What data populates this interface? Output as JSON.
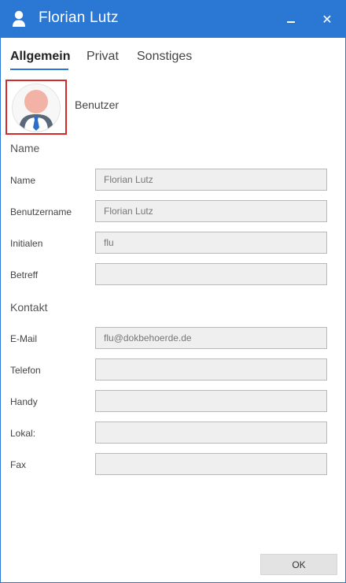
{
  "window": {
    "title": "Florian Lutz",
    "minimize_icon": "minimize-icon",
    "close_label": "✕",
    "accent_color": "#2b78d4"
  },
  "tabs": [
    {
      "label": "Allgemein",
      "active": true
    },
    {
      "label": "Privat",
      "active": false
    },
    {
      "label": "Sonstiges",
      "active": false
    }
  ],
  "avatar": {
    "caption": "Benutzer",
    "highlight_color": "#d42a2a"
  },
  "sections": {
    "name": "Name",
    "contact": "Kontakt"
  },
  "fields": {
    "name": {
      "label": "Name",
      "value": "Florian Lutz"
    },
    "username": {
      "label": "Benutzername",
      "value": "Florian Lutz"
    },
    "initials": {
      "label": "Initialen",
      "value": "flu"
    },
    "subject": {
      "label": "Betreff",
      "value": ""
    },
    "email": {
      "label": "E-Mail",
      "value": "flu@dokbehoerde.de"
    },
    "phone": {
      "label": "Telefon",
      "value": ""
    },
    "mobile": {
      "label": "Handy",
      "value": ""
    },
    "local": {
      "label": "Lokal:",
      "value": ""
    },
    "fax": {
      "label": "Fax",
      "value": ""
    }
  },
  "footer": {
    "ok_label": "OK"
  }
}
